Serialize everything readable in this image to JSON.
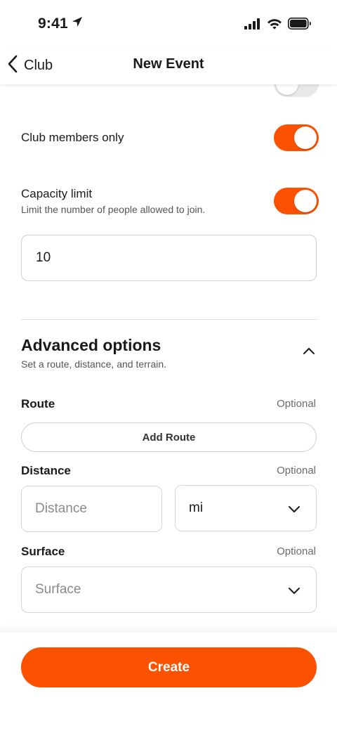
{
  "status_bar": {
    "time": "9:41",
    "icons": [
      "location-arrow-icon",
      "cellular-signal-icon",
      "wifi-icon",
      "battery-icon"
    ]
  },
  "nav": {
    "back_label": "Club",
    "title": "New Event"
  },
  "settings": {
    "members_only": {
      "label": "Club members only",
      "enabled": true
    },
    "capacity_limit": {
      "label": "Capacity limit",
      "description": "Limit the number of people allowed to join.",
      "enabled": true,
      "value": "10"
    }
  },
  "advanced": {
    "title": "Advanced options",
    "subtitle": "Set a route, distance, and terrain.",
    "expanded": true,
    "route": {
      "label": "Route",
      "optional": "Optional",
      "button": "Add Route"
    },
    "distance": {
      "label": "Distance",
      "optional": "Optional",
      "placeholder": "Distance",
      "unit": "mi"
    },
    "surface": {
      "label": "Surface",
      "optional": "Optional",
      "placeholder": "Surface"
    }
  },
  "footer": {
    "create_label": "Create"
  },
  "colors": {
    "accent": "#fc5200",
    "toggle_off": "#e8e8e8",
    "border": "#cfcfcf"
  }
}
